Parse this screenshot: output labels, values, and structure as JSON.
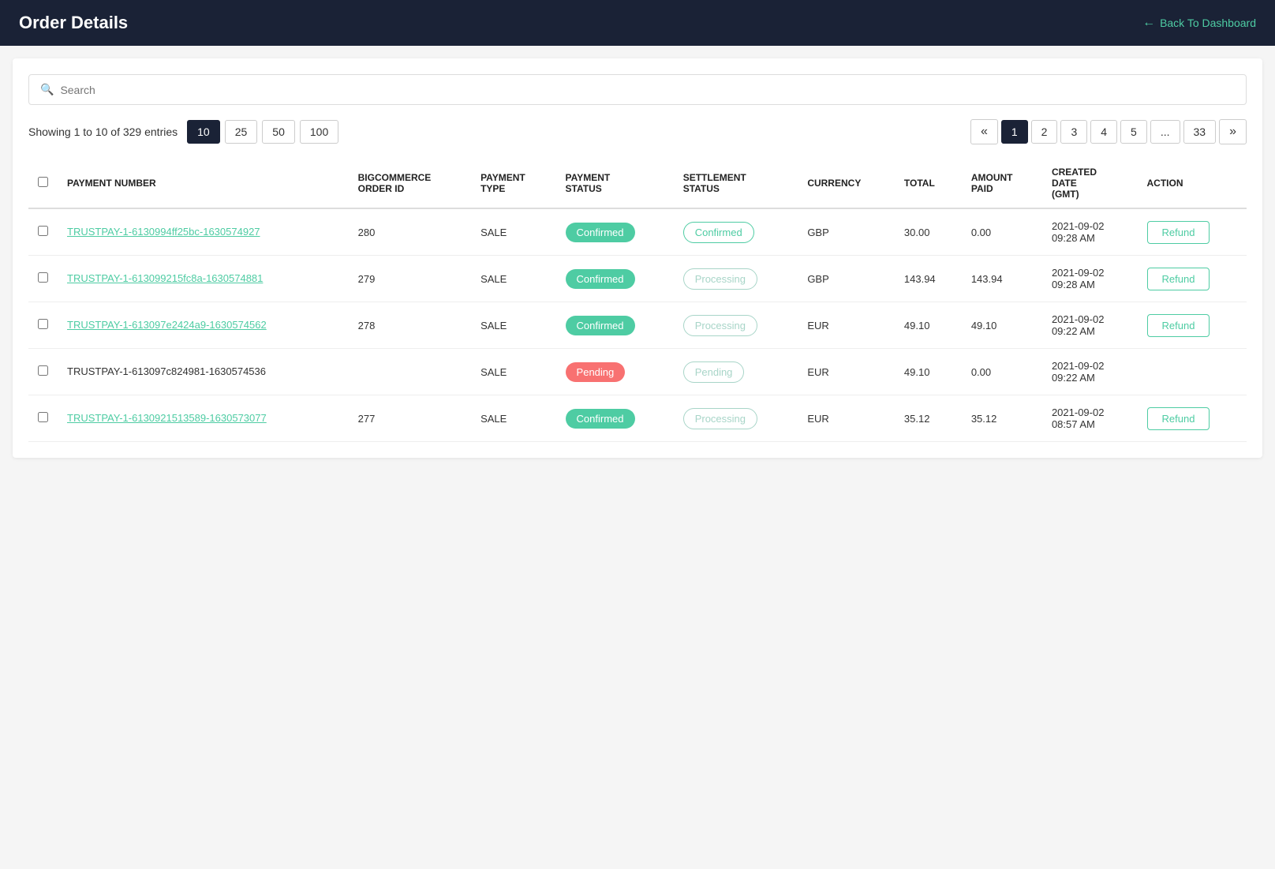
{
  "header": {
    "title": "Order Details",
    "back_label": "Back To Dashboard"
  },
  "search": {
    "placeholder": "Search"
  },
  "table_info": {
    "showing_text": "Showing 1 to 10 of 329 entries"
  },
  "per_page": {
    "options": [
      "10",
      "25",
      "50",
      "100"
    ],
    "active": "10"
  },
  "pagination": {
    "prev": "«",
    "next": "»",
    "pages": [
      "1",
      "2",
      "3",
      "4",
      "5",
      "...",
      "33"
    ],
    "active": "1"
  },
  "columns": {
    "payment_number": "PAYMENT NUMBER",
    "bigcommerce_order_id": "BIGCOMMERCE ORDER ID",
    "payment_type": "PAYMENT TYPE",
    "payment_status": "PAYMENT STATUS",
    "settlement_status": "SETTLEMENT STATUS",
    "currency": "CURRENCY",
    "total": "TOTAL",
    "amount_paid": "AMOUNT PAID",
    "created_date": "CREATED DATE (GMT)",
    "action": "ACTION"
  },
  "rows": [
    {
      "payment_number": "TRUSTPAY-1-6130994ff25bc-1630574927",
      "is_link": true,
      "bigcommerce_order_id": "280",
      "payment_type": "SALE",
      "payment_status": "Confirmed",
      "payment_status_style": "confirmed-solid",
      "settlement_status": "Confirmed",
      "settlement_status_style": "confirmed-outline",
      "currency": "GBP",
      "total": "30.00",
      "amount_paid": "0.00",
      "created_date": "2021-09-02\n09:28 AM",
      "has_refund": true
    },
    {
      "payment_number": "TRUSTPAY-1-613099215fc8a-1630574881",
      "is_link": true,
      "bigcommerce_order_id": "279",
      "payment_type": "SALE",
      "payment_status": "Confirmed",
      "payment_status_style": "confirmed-solid",
      "settlement_status": "Processing",
      "settlement_status_style": "processing",
      "currency": "GBP",
      "total": "143.94",
      "amount_paid": "143.94",
      "created_date": "2021-09-02\n09:28 AM",
      "has_refund": true
    },
    {
      "payment_number": "TRUSTPAY-1-613097e2424a9-1630574562",
      "is_link": true,
      "bigcommerce_order_id": "278",
      "payment_type": "SALE",
      "payment_status": "Confirmed",
      "payment_status_style": "confirmed-solid",
      "settlement_status": "Processing",
      "settlement_status_style": "processing",
      "currency": "EUR",
      "total": "49.10",
      "amount_paid": "49.10",
      "created_date": "2021-09-02\n09:22 AM",
      "has_refund": true
    },
    {
      "payment_number": "TRUSTPAY-1-613097c824981-1630574536",
      "is_link": false,
      "bigcommerce_order_id": "",
      "payment_type": "SALE",
      "payment_status": "Pending",
      "payment_status_style": "pending-solid",
      "settlement_status": "Pending",
      "settlement_status_style": "pending-outline",
      "currency": "EUR",
      "total": "49.10",
      "amount_paid": "0.00",
      "created_date": "2021-09-02\n09:22 AM",
      "has_refund": false
    },
    {
      "payment_number": "TRUSTPAY-1-6130921513589-1630573077",
      "is_link": true,
      "bigcommerce_order_id": "277",
      "payment_type": "SALE",
      "payment_status": "Confirmed",
      "payment_status_style": "confirmed-solid",
      "settlement_status": "Processing",
      "settlement_status_style": "processing",
      "currency": "EUR",
      "total": "35.12",
      "amount_paid": "35.12",
      "created_date": "2021-09-02\n08:57 AM",
      "has_refund": true
    }
  ],
  "refund_label": "Refund"
}
